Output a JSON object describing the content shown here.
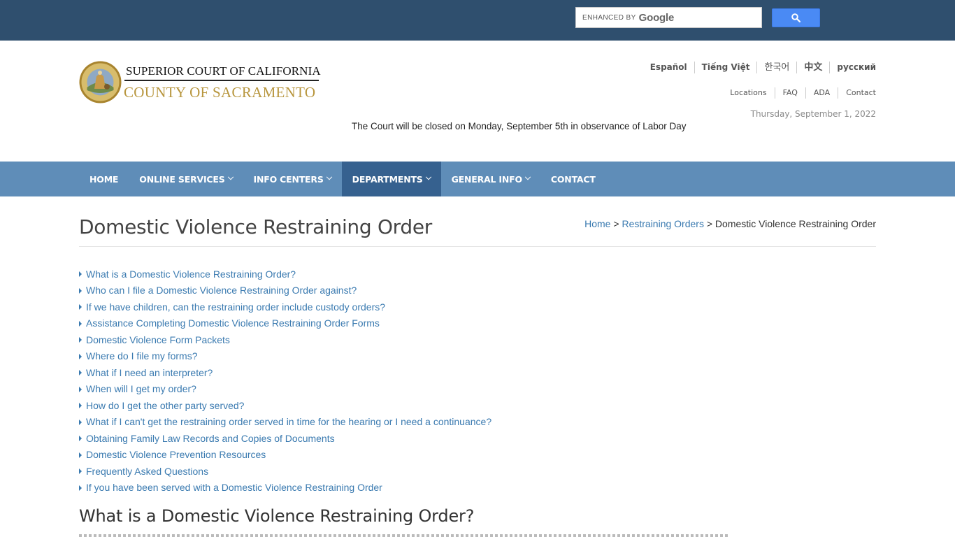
{
  "search": {
    "brand_small": "ENHANCED BY",
    "brand_name": "Google",
    "placeholder": ""
  },
  "header": {
    "logo_line1": "SUPERIOR COURT OF CALIFORNIA",
    "logo_line2": "COUNTY OF SACRAMENTO",
    "languages": [
      "Español",
      "Tiếng Việt",
      "한국어",
      "中文",
      "русский"
    ],
    "utility_links": [
      "Locations",
      "FAQ",
      "ADA",
      "Contact"
    ],
    "date": "Thursday, September 1, 2022",
    "notice": "The Court will be closed on Monday, September 5th in observance of Labor Day"
  },
  "nav": {
    "items": [
      "HOME",
      "ONLINE SERVICES",
      "INFO CENTERS",
      "DEPARTMENTS",
      "GENERAL INFO",
      "CONTACT"
    ],
    "active": "DEPARTMENTS"
  },
  "page": {
    "title": "Domestic Violence Restraining Order",
    "breadcrumb": [
      "Home",
      "Restraining Orders",
      "Domestic Violence Restraining Order"
    ],
    "breadcrumb_sep": ">",
    "toc": [
      "What is a Domestic Violence Restraining Order?",
      "Who can I file a Domestic Violence Restraining Order against?",
      "If we have children, can the restraining order include custody orders?",
      "Assistance Completing Domestic Violence Restraining Order Forms",
      "Domestic Violence Form Packets",
      "Where do I file my forms?",
      "What if I need an interpreter?",
      "When will I get my order?",
      "How do I get the other party served?",
      "What if I can't get the restraining order served in time for the hearing or I need a continuance?",
      "Obtaining Family Law Records and Copies of Documents",
      "Domestic Violence Prevention Resources",
      "Frequently Asked Questions",
      "If you have been served with a Domestic Violence Restraining Order"
    ],
    "section_heading": "What is a Domestic Violence Restraining Order?"
  },
  "colors": {
    "topbar": "#2f4f6e",
    "navbar": "#5f8db8",
    "nav_active": "#36618f",
    "link": "#3a7ab0",
    "logo_gold": "#b8963e",
    "search_button": "#4a8af4"
  },
  "icons": {
    "search_button": "search-icon",
    "nav_dropdown": "chevron-down-icon",
    "toc_bullet": "caret-right-icon",
    "logo": "court-seal"
  }
}
